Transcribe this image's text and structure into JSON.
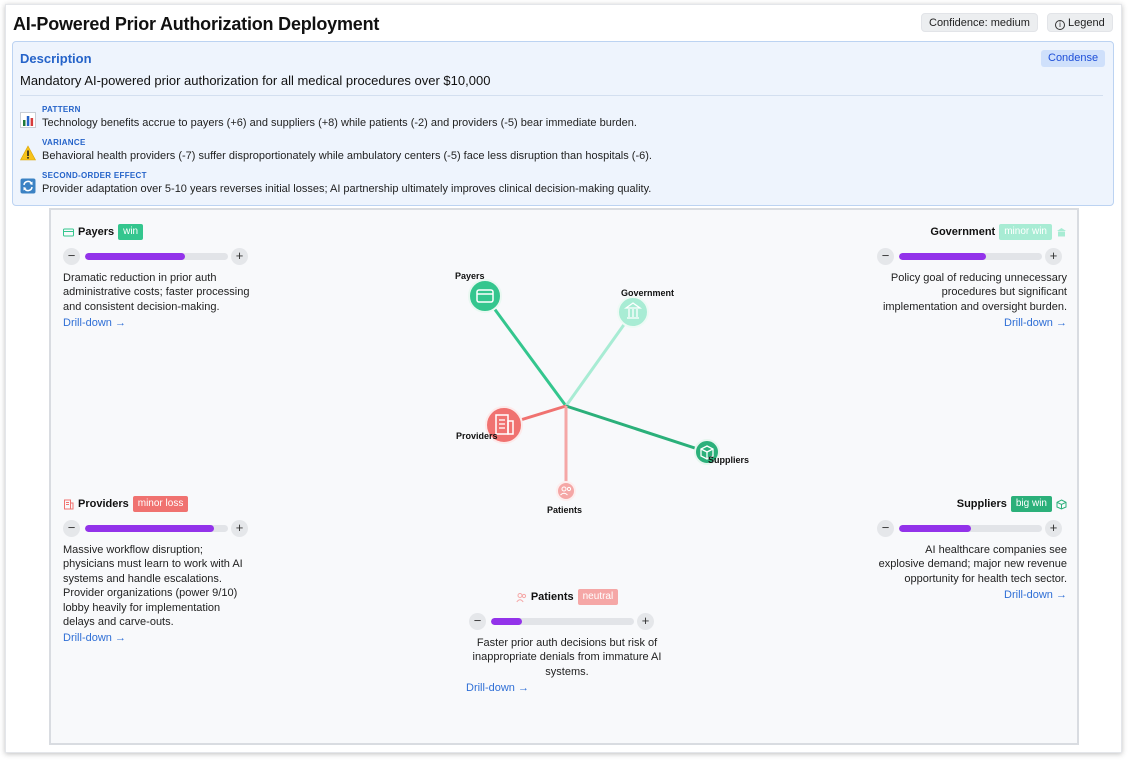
{
  "header": {
    "title": "AI-Powered Prior Authorization Deployment",
    "confidence_label": "Confidence: medium",
    "legend_label": "Legend"
  },
  "description": {
    "heading": "Description",
    "condense_label": "Condense",
    "text": "Mandatory AI-powered prior authorization for all medical procedures over $10,000",
    "insights": [
      {
        "label": "PATTERN",
        "icon": "bar-chart-icon",
        "text": "Technology benefits accrue to payers (+6) and suppliers (+8) while patients (-2) and providers (-5) bear immediate burden."
      },
      {
        "label": "VARIANCE",
        "icon": "warning-icon",
        "text": "Behavioral health providers (-7) suffer disproportionately while ambulatory centers (-5) face less disruption than hospitals (-6)."
      },
      {
        "label": "SECOND-ORDER EFFECT",
        "icon": "cycle-icon",
        "text": "Provider adaptation over 5-10 years reverses initial losses; AI partnership ultimately improves clinical decision-making quality."
      }
    ]
  },
  "colors": {
    "win": "#34c68e",
    "big_win": "#2bb07a",
    "minor_win": "#a8ecd4",
    "minor_loss": "#f07270",
    "neutral": "#f5a7a6",
    "bar_fill": "#9333ea",
    "link": "#2f6fd6"
  },
  "stakeholders": {
    "payers": {
      "name": "Payers",
      "badge": "win",
      "icon": "credit-card-icon",
      "level": 0.7,
      "text": "Dramatic reduction in prior auth administrative costs; faster processing and consistent decision-making.",
      "drill": "Drill-down →"
    },
    "government": {
      "name": "Government",
      "badge": "minor win",
      "icon": "building-icon",
      "level": 0.61,
      "text": "Policy goal of reducing unnecessary procedures but significant implementation and oversight burden.",
      "drill": "Drill-down →"
    },
    "providers": {
      "name": "Providers",
      "badge": "minor loss",
      "icon": "hospital-icon",
      "level": 0.9,
      "text": "Massive workflow disruption; physicians must learn to work with AI systems and handle escalations. Provider organizations (power 9/10) lobby heavily for implementation delays and carve-outs.",
      "drill": "Drill-down →"
    },
    "suppliers": {
      "name": "Suppliers",
      "badge": "big win",
      "icon": "package-icon",
      "level": 0.5,
      "text": "AI healthcare companies see explosive demand; major new revenue opportunity for health tech sector.",
      "drill": "Drill-down →"
    },
    "patients": {
      "name": "Patients",
      "badge": "neutral",
      "icon": "users-icon",
      "level": 0.22,
      "text": "Faster prior auth decisions but risk of inappropriate denials from immature AI systems.",
      "drill": "Drill-down →"
    }
  },
  "graph": {
    "labels": {
      "payers": "Payers",
      "government": "Government",
      "providers": "Providers",
      "suppliers": "Suppliers",
      "patients": "Patients"
    }
  }
}
